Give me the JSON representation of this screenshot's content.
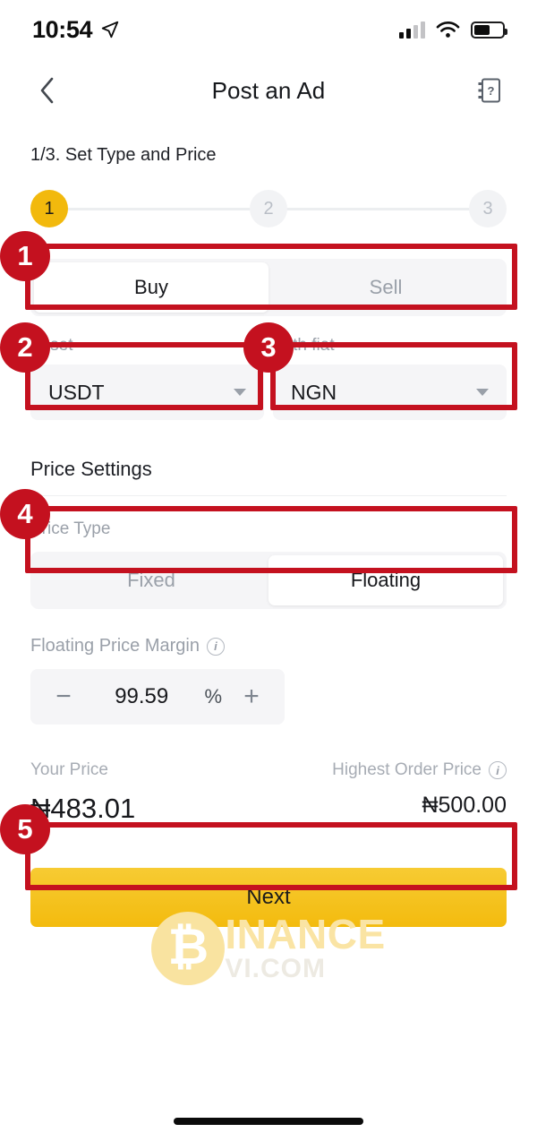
{
  "status_bar": {
    "time": "10:54",
    "location_icon": "location-arrow-icon",
    "signal_icon": "cellular-signal-icon",
    "wifi_icon": "wifi-icon",
    "battery_icon": "battery-icon"
  },
  "nav": {
    "back_icon": "chevron-left-icon",
    "title": "Post an Ad",
    "help_icon": "help-manual-icon"
  },
  "progress": {
    "step_title": "1/3. Set Type and Price",
    "steps": [
      {
        "label": "1",
        "state": "active"
      },
      {
        "label": "2",
        "state": "idle"
      },
      {
        "label": "3",
        "state": "idle"
      }
    ]
  },
  "side_toggle": {
    "options": [
      "Buy",
      "Sell"
    ],
    "selected": "Buy"
  },
  "asset": {
    "label": "Asset",
    "value": "USDT"
  },
  "fiat": {
    "label": "With fiat",
    "value": "NGN"
  },
  "price_settings": {
    "section_title": "Price Settings",
    "price_type_label": "Price Type",
    "price_type_options": [
      "Fixed",
      "Floating"
    ],
    "price_type_selected": "Floating",
    "margin_label": "Floating Price Margin",
    "margin_info_icon": "info-icon",
    "margin_minus": "−",
    "margin_value": "99.59",
    "margin_unit": "%",
    "margin_plus": "+"
  },
  "prices": {
    "your_price_label": "Your Price",
    "your_price_value": "₦483.01",
    "highest_label": "Highest Order Price",
    "highest_info_icon": "info-icon",
    "highest_value": "₦500.00"
  },
  "next_button": {
    "label": "Next"
  },
  "watermark": {
    "coin_glyph": "₿",
    "main_text": "INANCE",
    "sub_text": "VI.COM"
  },
  "annotations": [
    {
      "number": "1"
    },
    {
      "number": "2"
    },
    {
      "number": "3"
    },
    {
      "number": "4"
    },
    {
      "number": "5"
    }
  ],
  "colors": {
    "brand_yellow": "#f2b90d",
    "annotation_red": "#c4111f",
    "field_grey": "#f5f5f7",
    "text_primary": "#17181c",
    "text_muted": "#9aa0a9"
  }
}
